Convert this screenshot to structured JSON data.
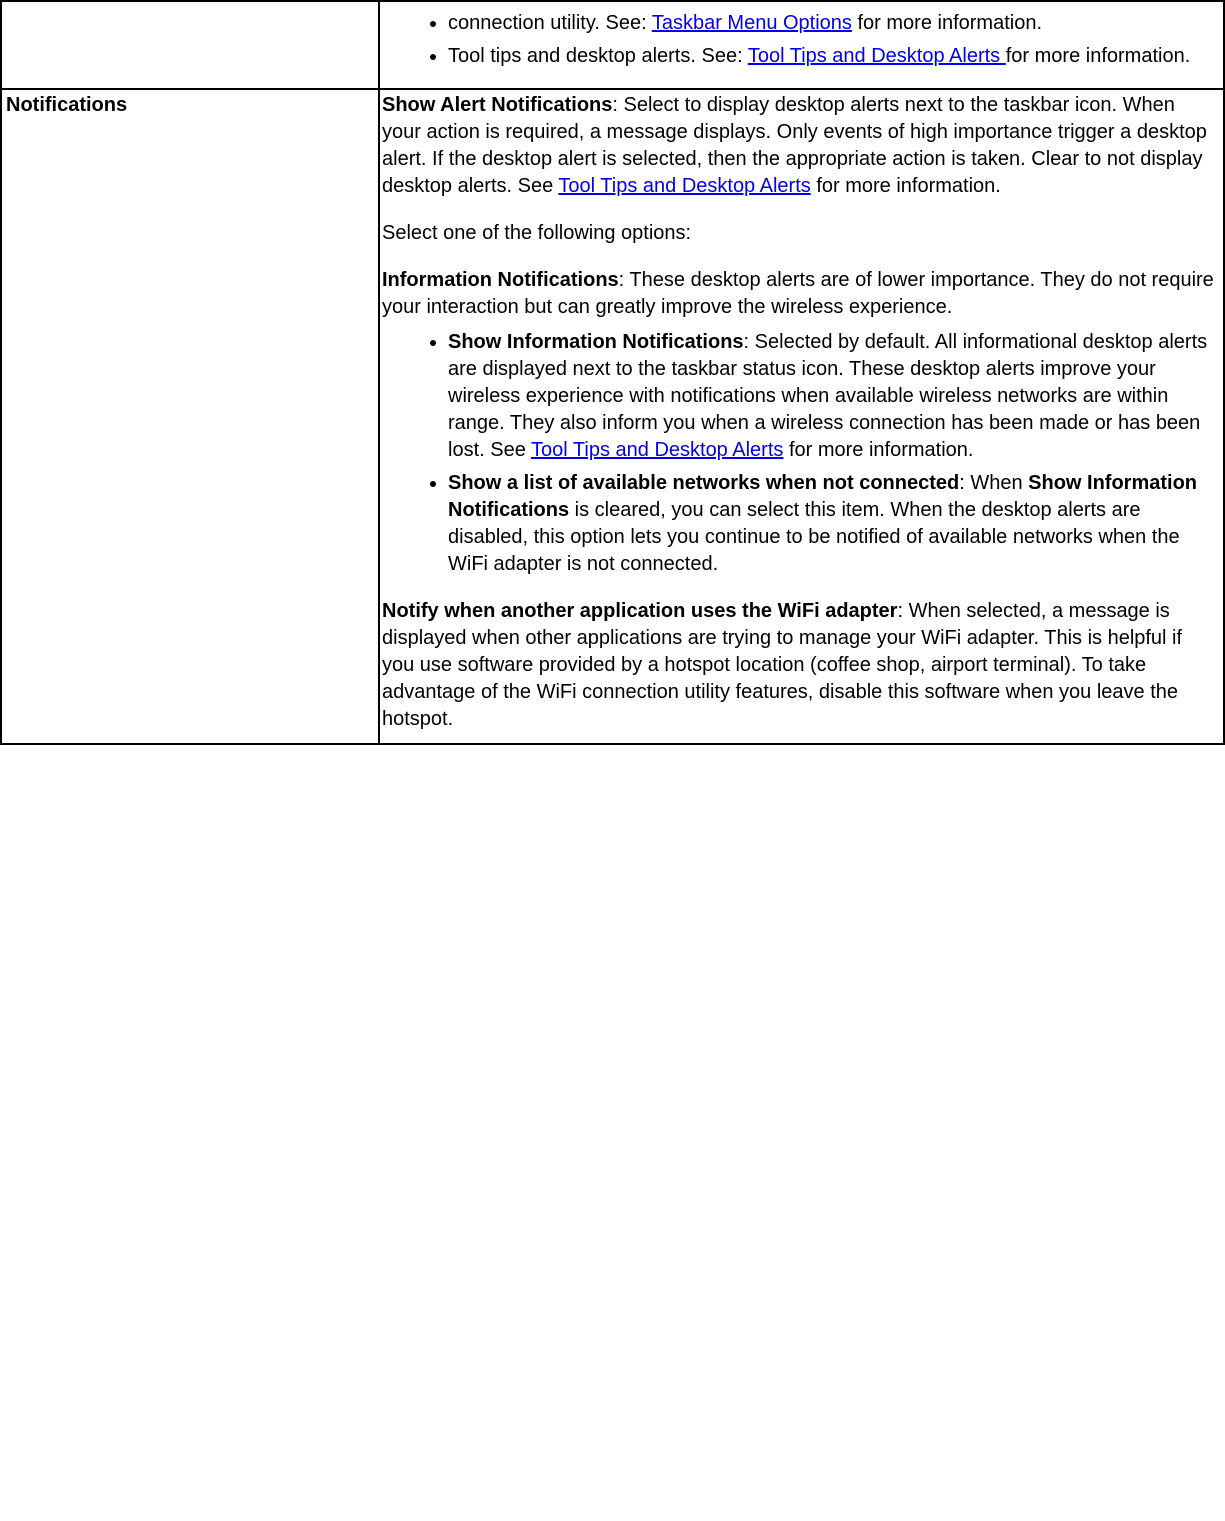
{
  "row1": {
    "item1_prefix": "connection utility. See: ",
    "item1_link": "Taskbar Menu Options",
    "item1_suffix": " for more information.",
    "item2_prefix": "Tool tips and desktop alerts. See: ",
    "item2_link": "Tool Tips and Desktop Alerts ",
    "item2_suffix": "for more information."
  },
  "row2": {
    "label": "Notifications",
    "p1": {
      "bold": "Show Alert Notifications",
      "text1": ": Select to display desktop alerts next to the taskbar icon. When your action is required, a message displays. Only events of high importance trigger a desktop alert. If the desktop alert is selected, then the appropriate action is taken. Clear to not display desktop alerts. See ",
      "link": "Tool Tips and Desktop Alerts",
      "text2": " for more information."
    },
    "p2": "Select one of the following options:",
    "p3": {
      "bold": "Information Notifications",
      "text": ": These desktop alerts are of lower importance. They do not require your interaction but can greatly improve the wireless experience."
    },
    "li1": {
      "bold": "Show Information Notifications",
      "text1": ": Selected by default. All informational desktop alerts are displayed next to the taskbar status icon. These desktop alerts improve your wireless experience with notifications when available wireless networks are within range. They also inform you when a wireless connection has been made or has been lost. See ",
      "link": "Tool Tips and Desktop Alerts",
      "text2": " for more information."
    },
    "li2": {
      "bold1": "Show a list of available networks when not connected",
      "text1": ": When ",
      "bold2": "Show Information Notifications",
      "text2": " is cleared, you can select this item. When the desktop alerts are disabled, this option lets you continue to be notified of available networks when the WiFi adapter is not connected."
    },
    "p4": {
      "bold": "Notify when another application uses the WiFi adapter",
      "text": ": When selected, a message is displayed when other applications are trying to manage your WiFi adapter. This is helpful if you use software provided by a hotspot location (coffee shop, airport terminal). To take advantage of the WiFi connection utility features, disable this software when you leave the hotspot."
    }
  }
}
